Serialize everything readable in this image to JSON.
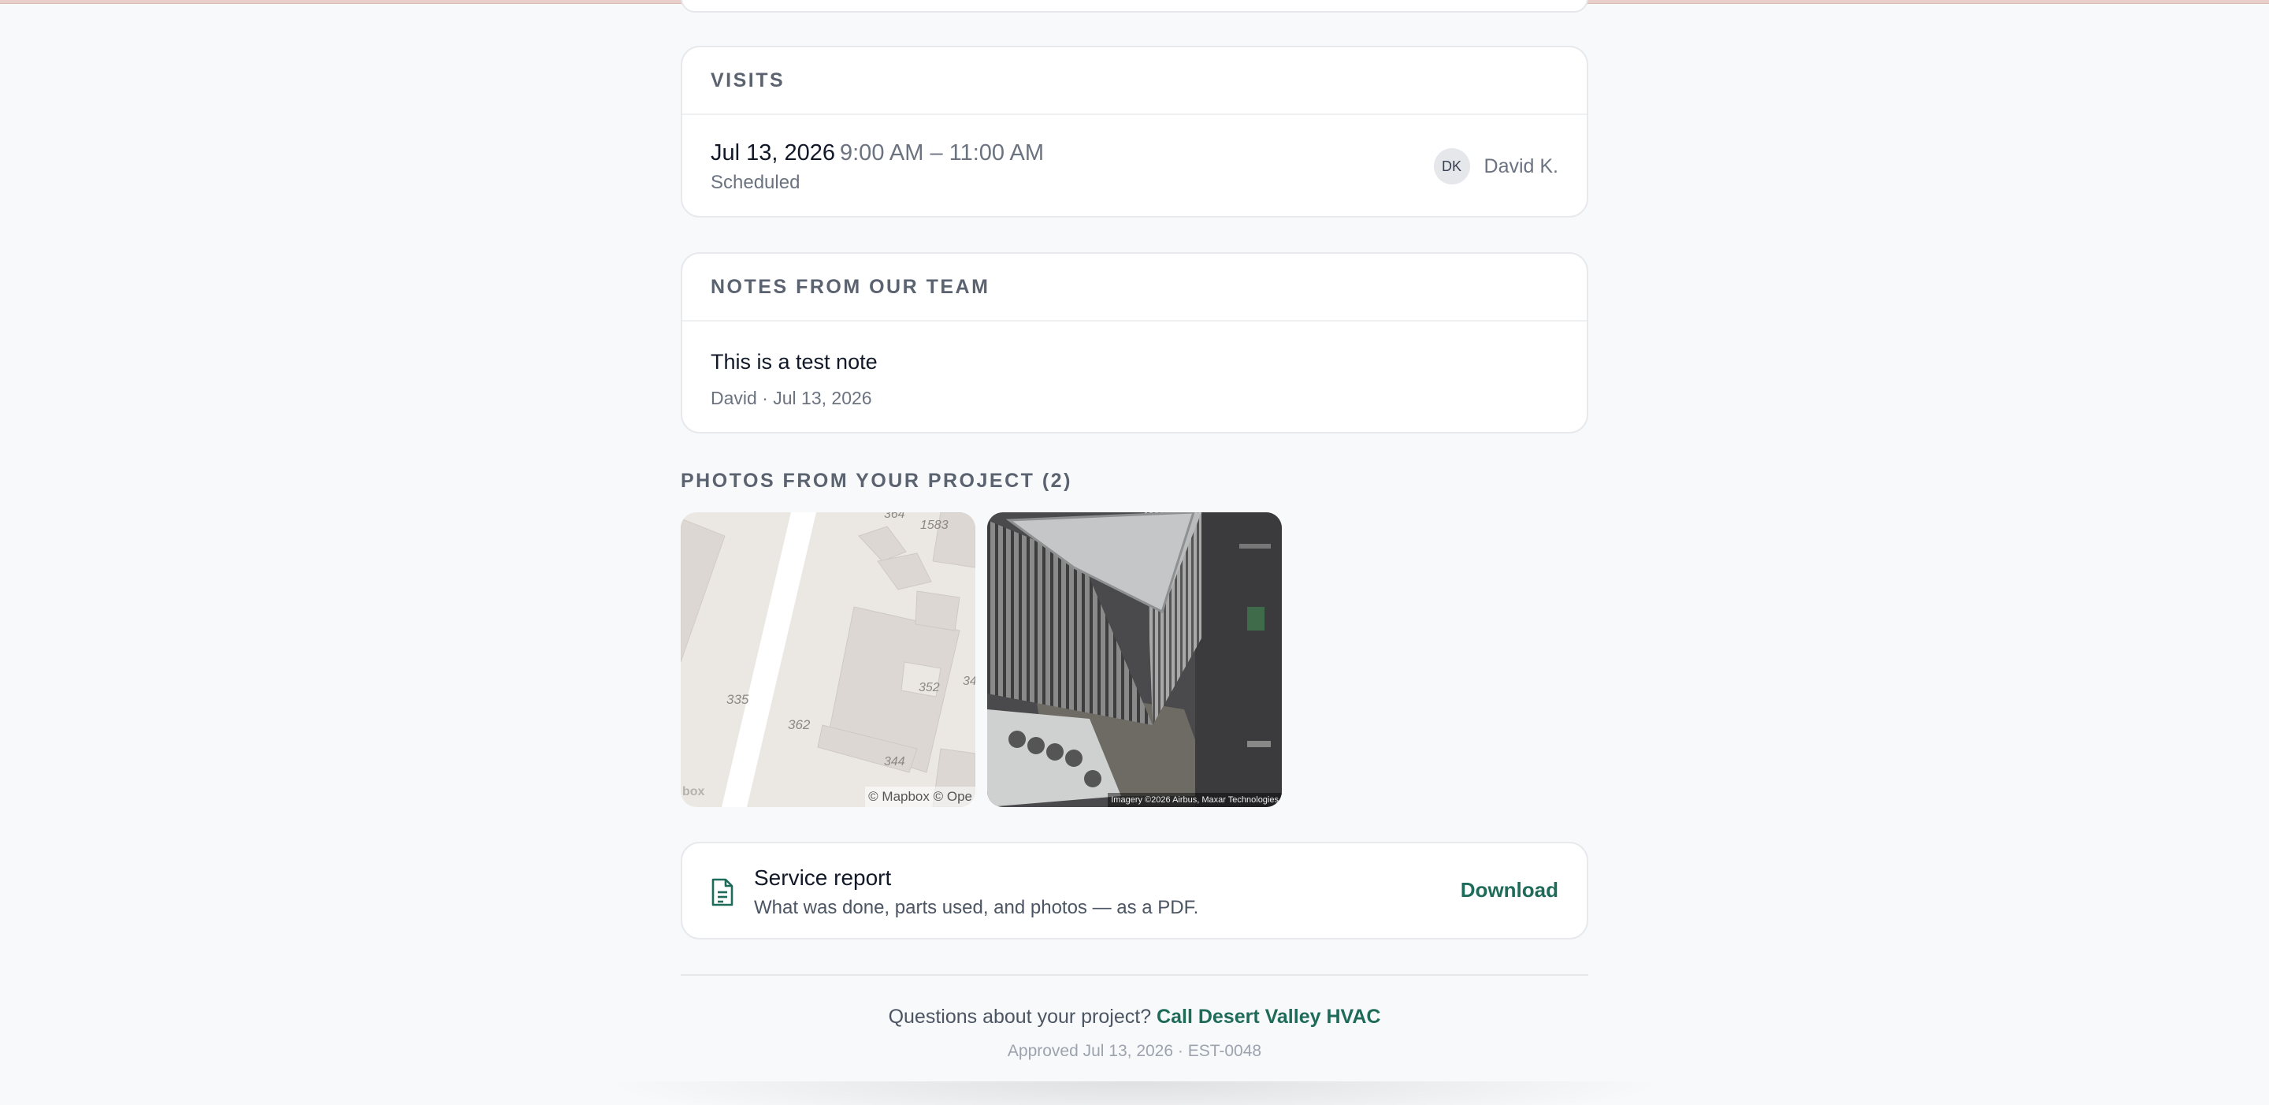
{
  "visits": {
    "header": "VISITS",
    "date": "Jul 13, 2026",
    "time": "9:00 AM – 11:00 AM",
    "status": "Scheduled",
    "assignee_initials": "DK",
    "assignee_name": "David K."
  },
  "notes": {
    "header": "NOTES FROM OUR TEAM",
    "text": "This is a test note",
    "meta": "David · Jul 13, 2026"
  },
  "photos": {
    "title": "PHOTOS FROM YOUR PROJECT (2)",
    "items": [
      {
        "kind": "map",
        "labels": [
          "364",
          "1583",
          "335",
          "362",
          "352",
          "344",
          "34"
        ],
        "attribution": "© Mapbox © Ope",
        "logo": "box"
      },
      {
        "kind": "satellite",
        "attribution": "Imagery ©2026 Airbus, Maxar Technologies"
      }
    ]
  },
  "report": {
    "title": "Service report",
    "subtitle": "What was done, parts used, and photos — as a PDF.",
    "download_label": "Download"
  },
  "footer": {
    "question": "Questions about your project?",
    "call_label": "Call Desert Valley HVAC",
    "meta": "Approved Jul 13, 2026 · EST-0048"
  },
  "colors": {
    "accent": "#1f6b5a",
    "background": "#f8f9fa"
  }
}
